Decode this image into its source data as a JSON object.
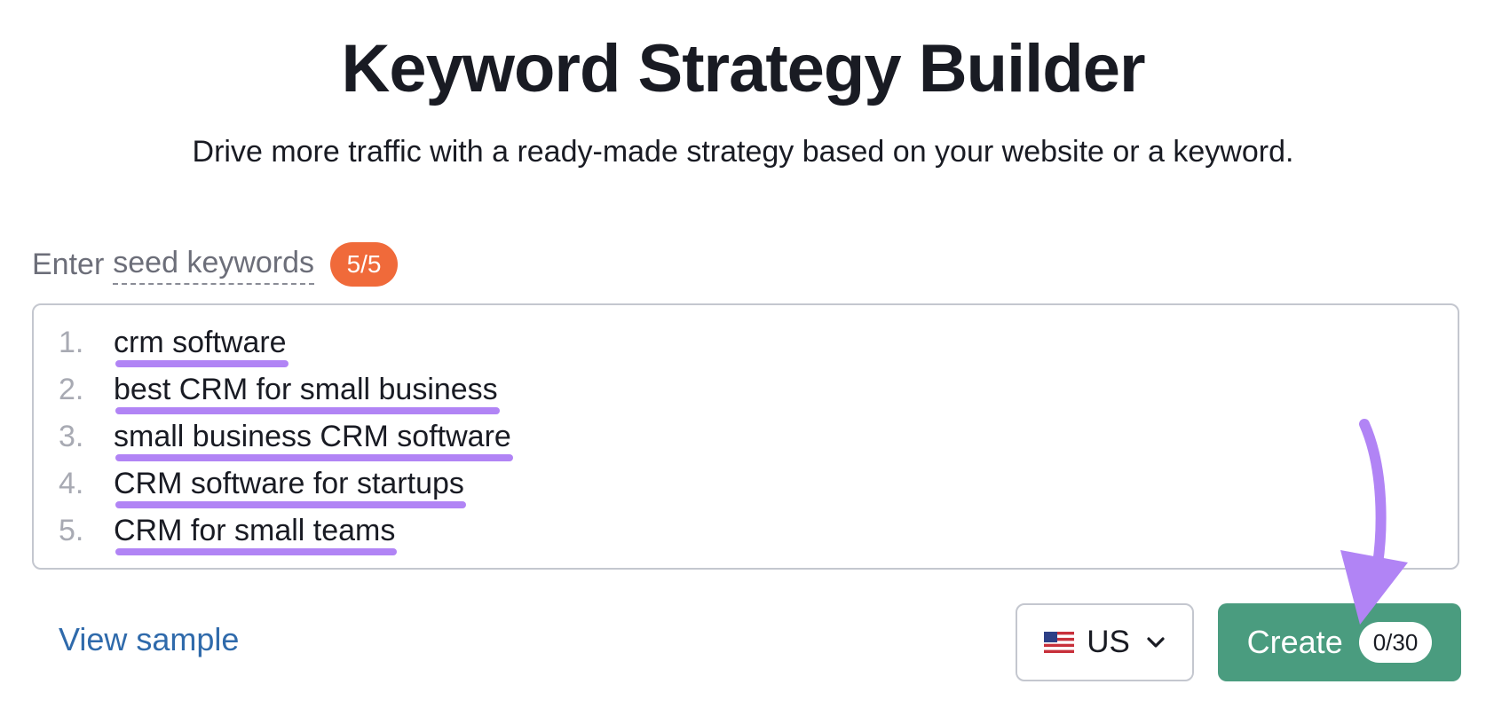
{
  "header": {
    "title": "Keyword Strategy Builder",
    "subtitle": "Drive more traffic with a ready-made strategy based on your website or a keyword."
  },
  "seed_input": {
    "label_prefix": "Enter",
    "label_term": "seed keywords",
    "count_badge": "5/5",
    "keywords": [
      {
        "number": "1.",
        "text": "crm software"
      },
      {
        "number": "2.",
        "text": "best CRM for small business"
      },
      {
        "number": "3.",
        "text": "small business CRM software"
      },
      {
        "number": "4.",
        "text": "CRM software for startups"
      },
      {
        "number": "5.",
        "text": "CRM for small teams"
      }
    ]
  },
  "footer": {
    "view_sample_label": "View sample",
    "database": {
      "selected": "US",
      "flag_icon": "us-flag-icon"
    },
    "create_button": {
      "label": "Create",
      "limit": "0/30"
    }
  },
  "colors": {
    "badge": "#f06a3a",
    "highlight_underline": "#b184f5",
    "create_button": "#4a9c7f",
    "link": "#2f6aab",
    "annotation_arrow": "#b184f5"
  }
}
